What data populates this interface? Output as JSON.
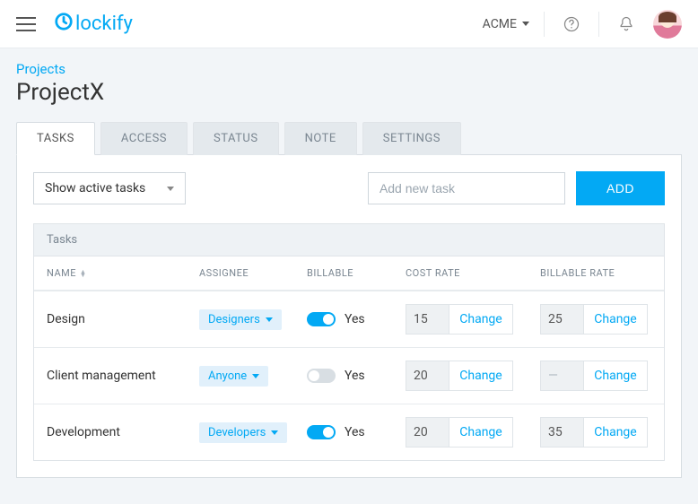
{
  "header": {
    "logo": "lockify",
    "workspace": "ACME"
  },
  "breadcrumb": "Projects",
  "page_title": "ProjectX",
  "tabs": [
    {
      "label": "TASKS",
      "active": true
    },
    {
      "label": "ACCESS",
      "active": false
    },
    {
      "label": "STATUS",
      "active": false
    },
    {
      "label": "NOTE",
      "active": false
    },
    {
      "label": "SETTINGS",
      "active": false
    }
  ],
  "filter": {
    "label": "Show active tasks"
  },
  "new_task": {
    "placeholder": "Add new task",
    "add_label": "ADD"
  },
  "table": {
    "title": "Tasks",
    "columns": {
      "name": "NAME",
      "assignee": "ASSIGNEE",
      "billable": "BILLABLE",
      "cost": "COST RATE",
      "billable_rate": "BILLABLE RATE"
    },
    "change_label": "Change",
    "billable_yes": "Yes",
    "rows": [
      {
        "name": "Design",
        "assignee": "Designers",
        "billable": true,
        "cost": "15",
        "billable_rate": "25"
      },
      {
        "name": "Client management",
        "assignee": "Anyone",
        "billable": false,
        "cost": "20",
        "billable_rate": "—"
      },
      {
        "name": "Development",
        "assignee": "Developers",
        "billable": true,
        "cost": "20",
        "billable_rate": "35"
      }
    ]
  }
}
